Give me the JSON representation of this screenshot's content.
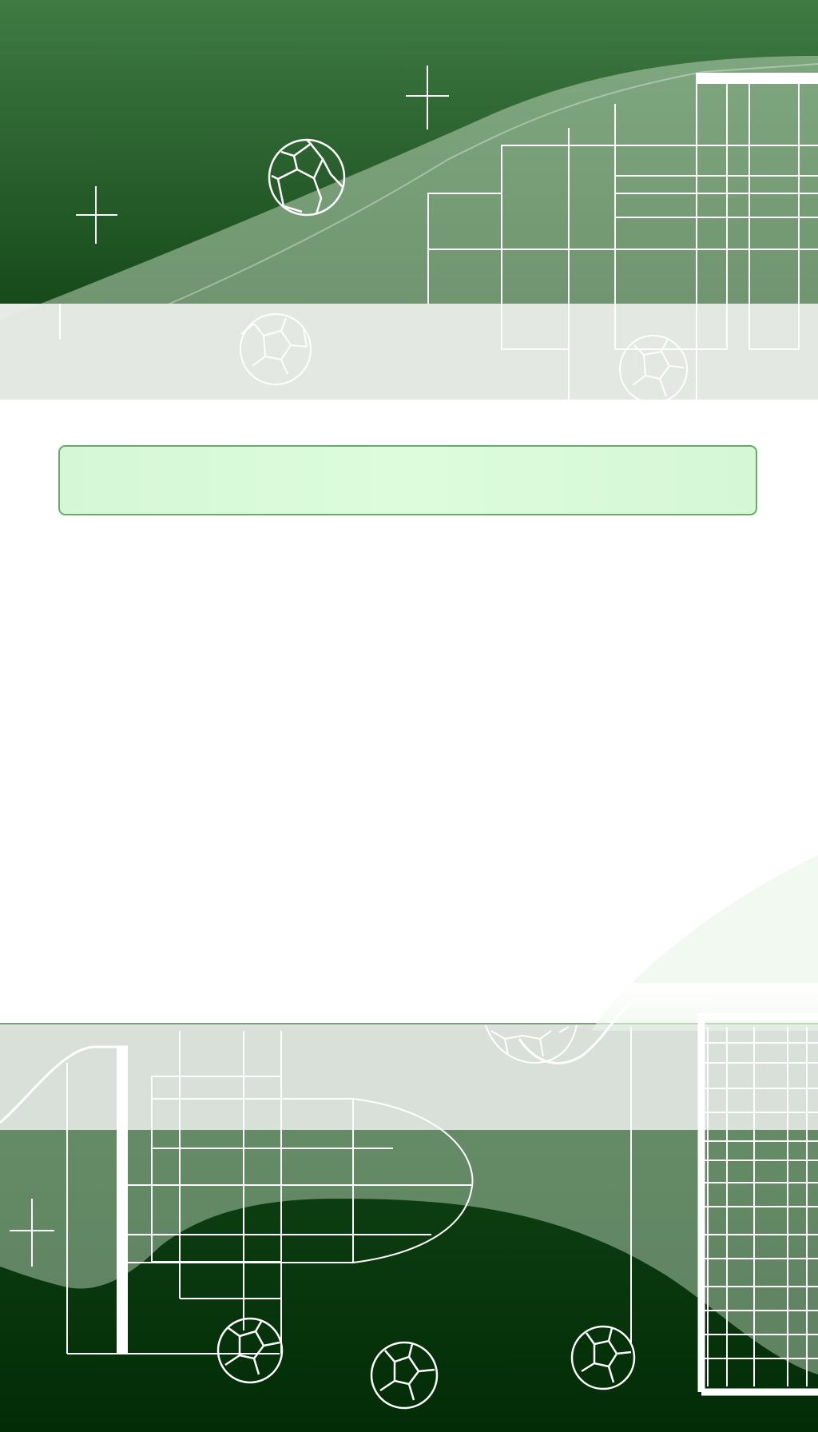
{
  "colors": {
    "dark_green": "#0e3a12",
    "mid_green": "#3a7a42",
    "light_green": "#dcfcdc",
    "band_grey": "#dfe4df",
    "line_white": "#ffffff",
    "border_green": "#6aa86c"
  },
  "title": {
    "text": ""
  },
  "decor": {
    "top_icons": [
      "soccer-ball-icon",
      "sparkle-icon",
      "goal-net-icon"
    ],
    "bottom_icons": [
      "soccer-ball-icon",
      "sparkle-icon",
      "goal-net-icon"
    ]
  }
}
